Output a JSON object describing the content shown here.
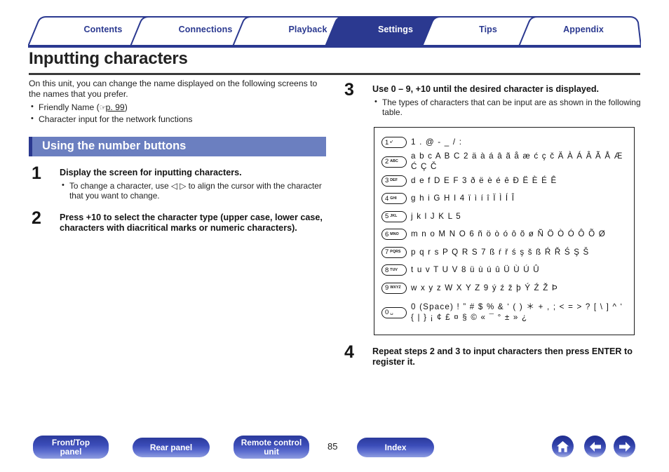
{
  "nav": {
    "tabs": [
      {
        "label": "Contents",
        "active": false
      },
      {
        "label": "Connections",
        "active": false
      },
      {
        "label": "Playback",
        "active": false
      },
      {
        "label": "Settings",
        "active": true
      },
      {
        "label": "Tips",
        "active": false
      },
      {
        "label": "Appendix",
        "active": false
      }
    ],
    "active_color": "#2b3990",
    "tab_text_color": "#2b3990"
  },
  "page": {
    "title": "Inputting characters",
    "number": "85"
  },
  "intro": {
    "paragraph": "On this unit, you can change the name displayed on the following screens to the names that you prefer.",
    "bullets": [
      {
        "text": "Friendly Name",
        "ref_prefix": "(",
        "ref_hand": "☞",
        "ref_link": "p. 99",
        "ref_suffix": ")"
      },
      {
        "text": "Character input for the network functions",
        "ref_prefix": "",
        "ref_hand": "",
        "ref_link": "",
        "ref_suffix": ""
      }
    ]
  },
  "section": {
    "heading": "Using the number buttons",
    "bar_color": "#6b7fc0",
    "bar_accent": "#2b3990"
  },
  "steps": [
    {
      "num": "1",
      "head": "Display the screen for inputting characters.",
      "bullets": [
        "To change a character, use ◁ ▷ to align the cursor with the character that you want to change."
      ]
    },
    {
      "num": "2",
      "head": "Press +10 to select the character type (upper case, lower case, characters with diacritical marks or numeric characters).",
      "bullets": []
    },
    {
      "num": "3",
      "head": "Use 0 – 9, +10 until the desired character is displayed.",
      "bullets": [
        "The types of characters that can be input are as shown in the following table."
      ]
    },
    {
      "num": "4",
      "head": "Repeat steps 2 and 3 to input characters then press ENTER to register it.",
      "bullets": []
    }
  ],
  "char_table": {
    "rows": [
      {
        "key_num": "1",
        "key_letters": "",
        "key_symbol": "•′",
        "chars": "1 . @ - _ / :",
        "chars2": ""
      },
      {
        "key_num": "2",
        "key_letters": "ABC",
        "key_symbol": "",
        "chars": "a b c A B C 2 ä à á â ã å æ ć ç č Ä À Á Â Ã Å Æ Ć Ç Č",
        "chars2": ""
      },
      {
        "key_num": "3",
        "key_letters": "DEF",
        "key_symbol": "",
        "chars": "d e f D E F 3 ð ë è é ê Ð Ë È É Ê",
        "chars2": ""
      },
      {
        "key_num": "4",
        "key_letters": "GHI",
        "key_symbol": "",
        "chars": "g h i G H I 4 ï ì í î Ï Ì Í Î",
        "chars2": ""
      },
      {
        "key_num": "5",
        "key_letters": "JKL",
        "key_symbol": "",
        "chars": "j k l J K L 5",
        "chars2": ""
      },
      {
        "key_num": "6",
        "key_letters": "MNO",
        "key_symbol": "",
        "chars": "m n o M N O 6 ñ ö ò ó ô õ ø Ñ Ö Ò Ó Ô Õ Ø",
        "chars2": ""
      },
      {
        "key_num": "7",
        "key_letters": "PQRS",
        "key_symbol": "",
        "chars": "p q r s P Q R S 7 ß ŕ ř ś ş š ß Ŕ Ř Ś Ş Š",
        "chars2": ""
      },
      {
        "key_num": "8",
        "key_letters": "TUV",
        "key_symbol": "",
        "chars": "t u v T U V 8 ü ù ú û Ü Ù Ú Û",
        "chars2": ""
      },
      {
        "key_num": "9",
        "key_letters": "WXYZ",
        "key_symbol": "",
        "chars": "w x y z W X Y Z 9 ý ź ž þ Ý Ź Ž Þ",
        "chars2": ""
      },
      {
        "key_num": "0",
        "key_letters": "",
        "key_symbol": "␣",
        "chars": "0  (Space)  ! ” # $ % & ‘ ( ) ＊ + , ; < = > ? [ \\ ] ^ ‘",
        "chars2": "{ | } ¡ ¢ £ ¤ § © « ¯ ° ± » ¿"
      }
    ]
  },
  "footer": {
    "buttons": [
      {
        "label": "Front/Top\npanel",
        "line1": "Front/Top",
        "line2": "panel"
      },
      {
        "label": "Rear panel",
        "line1": "Rear panel",
        "line2": ""
      },
      {
        "label": "Remote control\nunit",
        "line1": "Remote control",
        "line2": "unit"
      },
      {
        "label": "Index",
        "line1": "Index",
        "line2": ""
      }
    ],
    "icons": [
      {
        "name": "home-icon"
      },
      {
        "name": "back-arrow-icon"
      },
      {
        "name": "forward-arrow-icon"
      }
    ]
  }
}
